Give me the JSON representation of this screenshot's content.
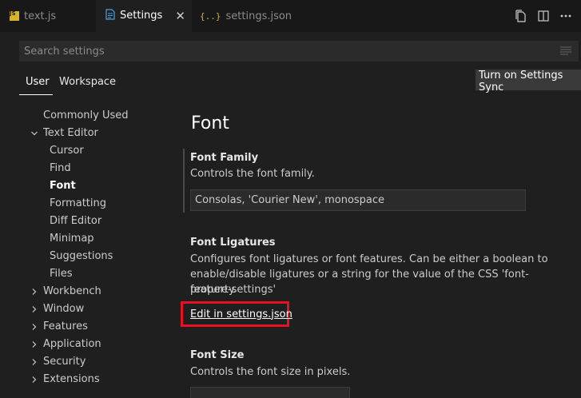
{
  "tabs": [
    {
      "label": "text.js",
      "icon": "js-file-icon",
      "active": false
    },
    {
      "label": "Settings",
      "icon": "settings-file-icon",
      "active": true
    },
    {
      "label": "settings.json",
      "icon": "json-braces-icon",
      "active": false
    }
  ],
  "tab_actions": {
    "open_json_icon": "open-settings-json-icon",
    "split_icon": "split-editor-icon",
    "more_icon": "more-actions-icon"
  },
  "js_badge": "JS",
  "json_badge": "{..}",
  "search": {
    "placeholder": "Search settings",
    "value": ""
  },
  "scopes": {
    "user": "User",
    "workspace": "Workspace"
  },
  "sync_button": "Turn on Settings Sync",
  "toc": [
    {
      "label": "Commonly Used",
      "expandable": false
    },
    {
      "label": "Text Editor",
      "expandable": true,
      "expanded": true
    },
    {
      "label": "Cursor"
    },
    {
      "label": "Find"
    },
    {
      "label": "Font",
      "active": true
    },
    {
      "label": "Formatting"
    },
    {
      "label": "Diff Editor"
    },
    {
      "label": "Minimap"
    },
    {
      "label": "Suggestions"
    },
    {
      "label": "Files"
    },
    {
      "label": "Workbench",
      "expandable": true
    },
    {
      "label": "Window",
      "expandable": true
    },
    {
      "label": "Features",
      "expandable": true
    },
    {
      "label": "Application",
      "expandable": true
    },
    {
      "label": "Security",
      "expandable": true
    },
    {
      "label": "Extensions",
      "expandable": true
    }
  ],
  "section_title": "Font",
  "font_family": {
    "title": "Font Family",
    "description": "Controls the font family.",
    "value": "Consolas, 'Courier New', monospace"
  },
  "font_ligatures": {
    "title": "Font Ligatures",
    "description_lines": [
      "Configures font ligatures or font features. Can be either a boolean to",
      "enable/disable ligatures or a string for the value of the CSS 'font-feature-settings'",
      "property."
    ],
    "link": "Edit in settings.json"
  },
  "font_size": {
    "title": "Font Size",
    "description": "Controls the font size in pixels."
  },
  "colors": {
    "accent": "#0078d4",
    "highlight_box": "#e81123",
    "section_title": "#ffffff"
  }
}
